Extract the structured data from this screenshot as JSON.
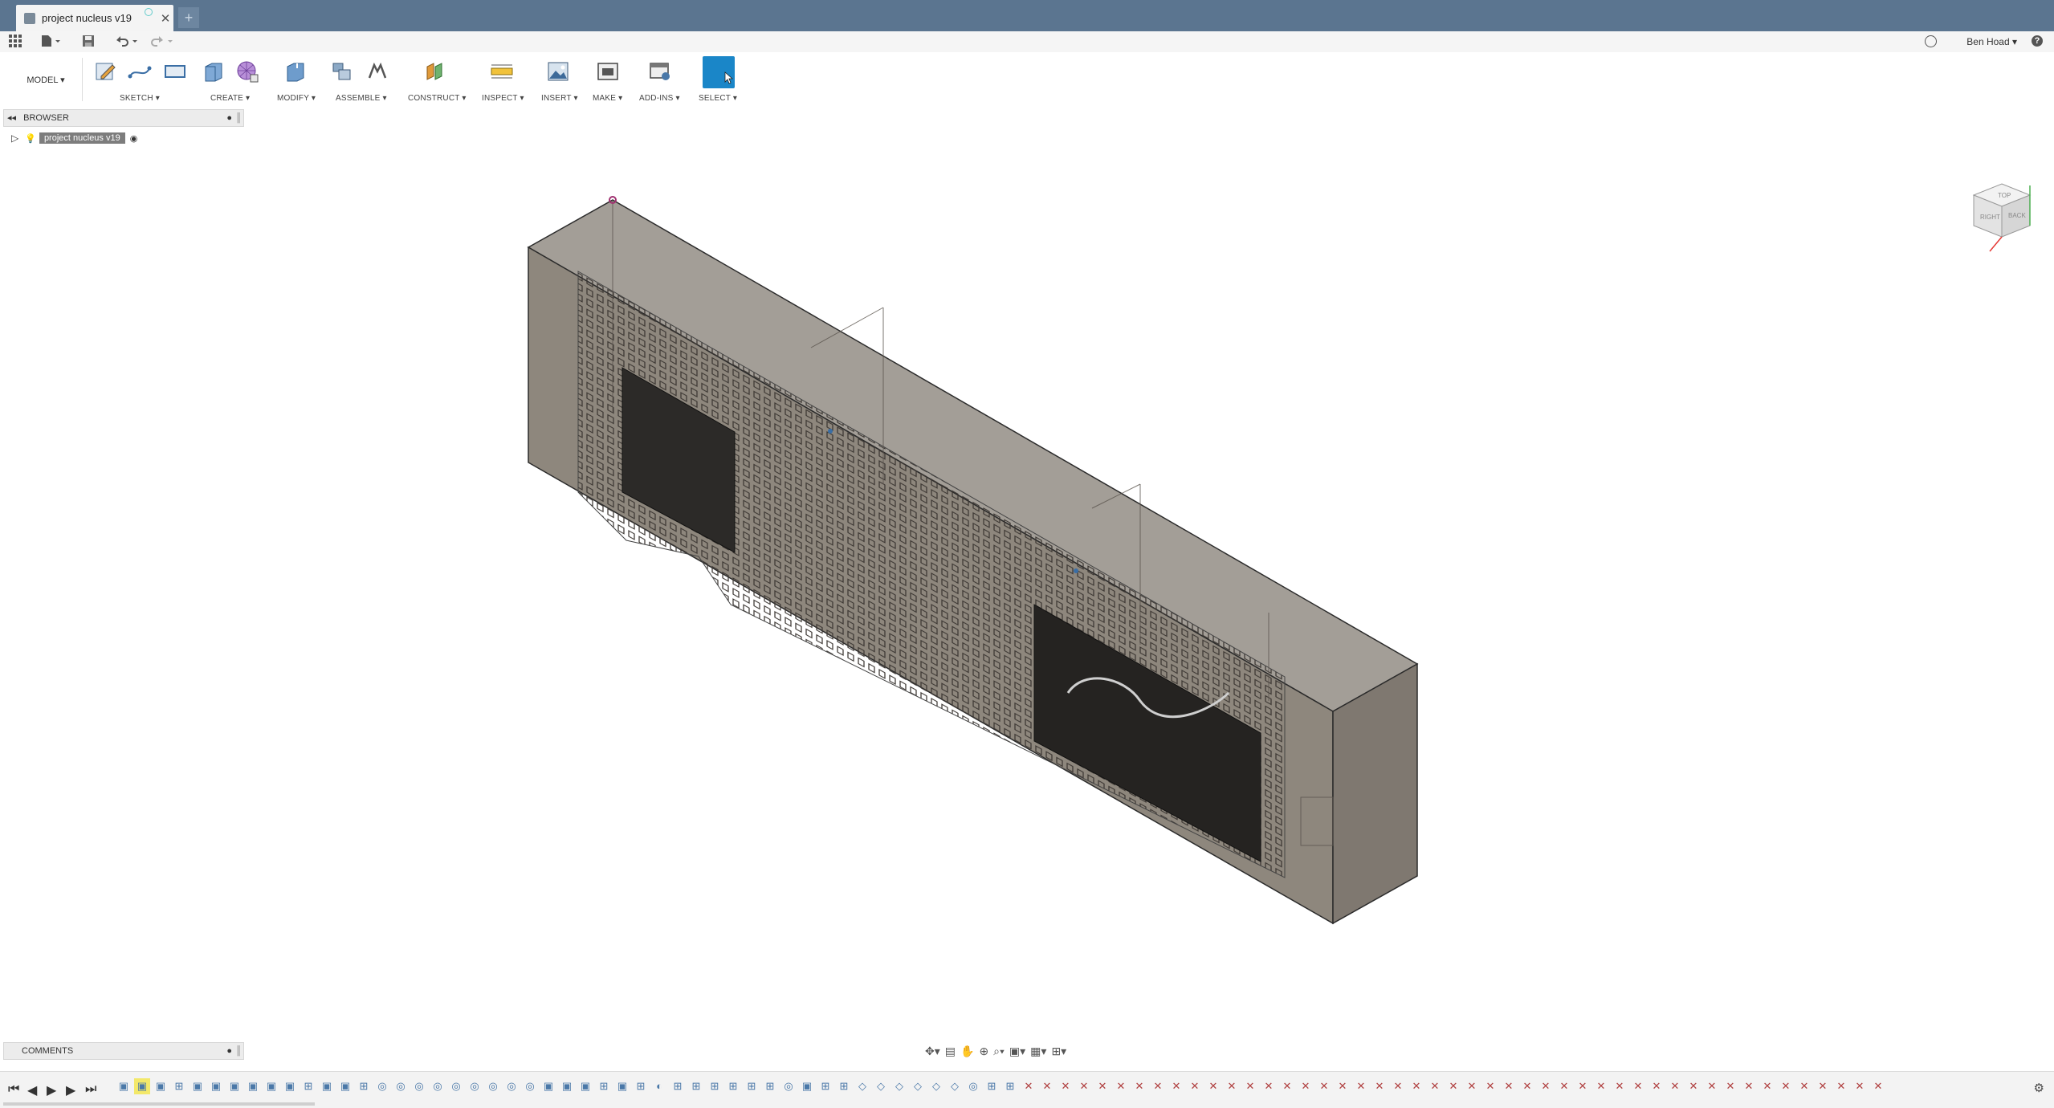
{
  "tab": {
    "title": "project nucleus v19",
    "close": "✕",
    "new": "+"
  },
  "user": {
    "name": "Ben Hoad ▾"
  },
  "workspace": {
    "label": "MODEL ▾"
  },
  "ribbon": {
    "sketch": "SKETCH ▾",
    "create": "CREATE ▾",
    "modify": "MODIFY ▾",
    "assemble": "ASSEMBLE ▾",
    "construct": "CONSTRUCT ▾",
    "inspect": "INSPECT ▾",
    "insert": "INSERT ▾",
    "make": "MAKE ▾",
    "addins": "ADD-INS ▾",
    "select": "SELECT ▾"
  },
  "browser": {
    "title": "BROWSER",
    "root": "project nucleus v19"
  },
  "comments": {
    "title": "COMMENTS"
  },
  "viewcube": {
    "top": "TOP",
    "right": "RIGHT",
    "back": "BACK"
  },
  "timeline": {
    "items": [
      "▣",
      "▣",
      "▣",
      "⊞",
      "▣",
      "▣",
      "▣",
      "▣",
      "▣",
      "▣",
      "⊞",
      "▣",
      "▣",
      "⊞",
      "◎",
      "◎",
      "◎",
      "◎",
      "◎",
      "◎",
      "◎",
      "◎",
      "◎",
      "▣",
      "▣",
      "▣",
      "⊞",
      "▣",
      "⊞",
      "◐",
      "⊞",
      "⊞",
      "⊞",
      "⊞",
      "⊞",
      "⊞",
      "◎",
      "▣",
      "⊞",
      "⊞",
      "◇",
      "◇",
      "◇",
      "◇",
      "◇",
      "◇",
      "◎",
      "⊞",
      "⊞",
      "✕",
      "✕",
      "✕",
      "✕",
      "✕",
      "✕",
      "✕",
      "✕",
      "✕",
      "✕",
      "✕",
      "✕",
      "✕",
      "✕",
      "✕",
      "✕",
      "✕",
      "✕",
      "✕",
      "✕",
      "✕",
      "✕",
      "✕",
      "✕",
      "✕",
      "✕",
      "✕",
      "✕",
      "✕",
      "✕",
      "✕",
      "✕",
      "✕",
      "✕",
      "✕",
      "✕",
      "✕",
      "✕",
      "✕",
      "✕",
      "✕",
      "✕",
      "✕",
      "✕",
      "✕",
      "✕",
      "✕"
    ],
    "selected_index": 1
  }
}
